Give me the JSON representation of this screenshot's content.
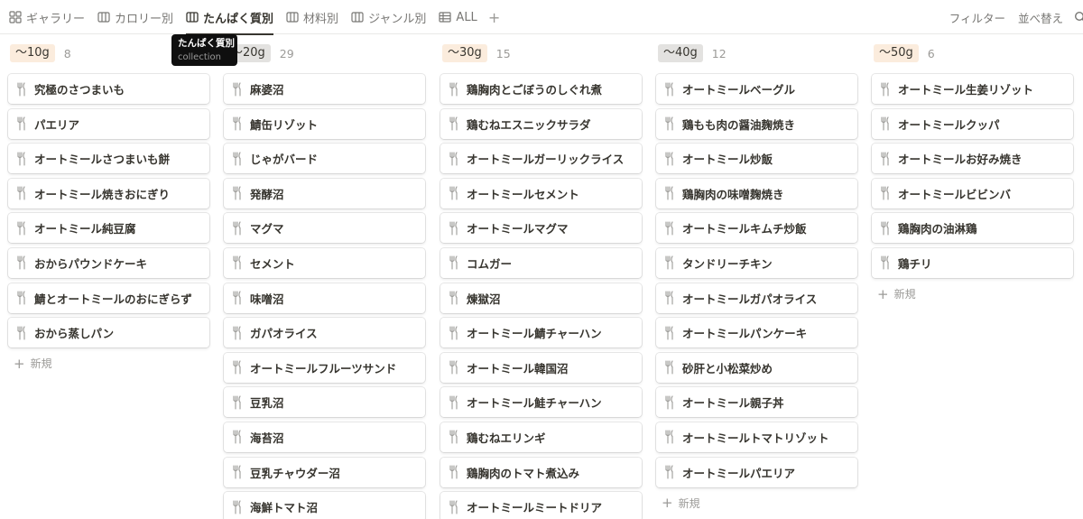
{
  "views": {
    "tabs": [
      {
        "label": "ギャラリー",
        "icon": "gallery-icon",
        "active": false
      },
      {
        "label": "カロリー別",
        "icon": "board-icon",
        "active": false
      },
      {
        "label": "たんぱく質別",
        "icon": "board-icon",
        "active": true
      },
      {
        "label": "材料別",
        "icon": "board-icon",
        "active": false
      },
      {
        "label": "ジャンル別",
        "icon": "board-icon",
        "active": false
      },
      {
        "label": "ALL",
        "icon": "table-icon",
        "active": false
      }
    ],
    "add_label": "+",
    "filter_label": "フィルター",
    "sort_label": "並べ替え"
  },
  "tooltip": {
    "title": "たんぱく質別",
    "subtitle": "collection"
  },
  "board": {
    "new_label": "新規",
    "columns": [
      {
        "label": "〜10g",
        "count": "8",
        "color": "#fbecdd",
        "cards": [
          "究極のさつまいも",
          "パエリア",
          "オートミールさつまいも餅",
          "オートミール焼きおにぎり",
          "オートミール純豆腐",
          "おからパウンドケーキ",
          "鯖とオートミールのおにぎらず",
          "おから蒸しパン"
        ]
      },
      {
        "label": "〜20g",
        "count": "29",
        "color": "#e3e2e0",
        "cards": [
          "麻婆沼",
          "鯖缶リゾット",
          "じゃがバード",
          "発酵沼",
          "マグマ",
          "セメント",
          "味噌沼",
          "ガパオライス",
          "オートミールフルーツサンド",
          "豆乳沼",
          "海苔沼",
          "豆乳チャウダー沼",
          "海鮮トマト沼"
        ]
      },
      {
        "label": "〜30g",
        "count": "15",
        "color": "#fbecdd",
        "cards": [
          "鶏胸肉とごぼうのしぐれ煮",
          "鶏むねエスニックサラダ",
          "オートミールガーリックライス",
          "オートミールセメント",
          "オートミールマグマ",
          "コムガー",
          "煉獄沼",
          "オートミール鯖チャーハン",
          "オートミール韓国沼",
          "オートミール鮭チャーハン",
          "鶏むねエリンギ",
          "鶏胸肉のトマト煮込み",
          "オートミールミートドリア"
        ]
      },
      {
        "label": "〜40g",
        "count": "12",
        "color": "#e3e2e0",
        "cards": [
          "オートミールベーグル",
          "鶏もも肉の醤油麹焼き",
          "オートミール炒飯",
          "鶏胸肉の味噌麹焼き",
          "オートミールキムチ炒飯",
          "タンドリーチキン",
          "オートミールガパオライス",
          "オートミールパンケーキ",
          "砂肝と小松菜炒め",
          "オートミール親子丼",
          "オートミールトマトリゾット",
          "オートミールパエリア"
        ]
      },
      {
        "label": "〜50g",
        "count": "6",
        "color": "#fbecdd",
        "cards": [
          "オートミール生姜リゾット",
          "オートミールクッパ",
          "オートミールお好み焼き",
          "オートミールビビンバ",
          "鶏胸肉の油淋鶏",
          "鶏チリ"
        ]
      }
    ]
  }
}
